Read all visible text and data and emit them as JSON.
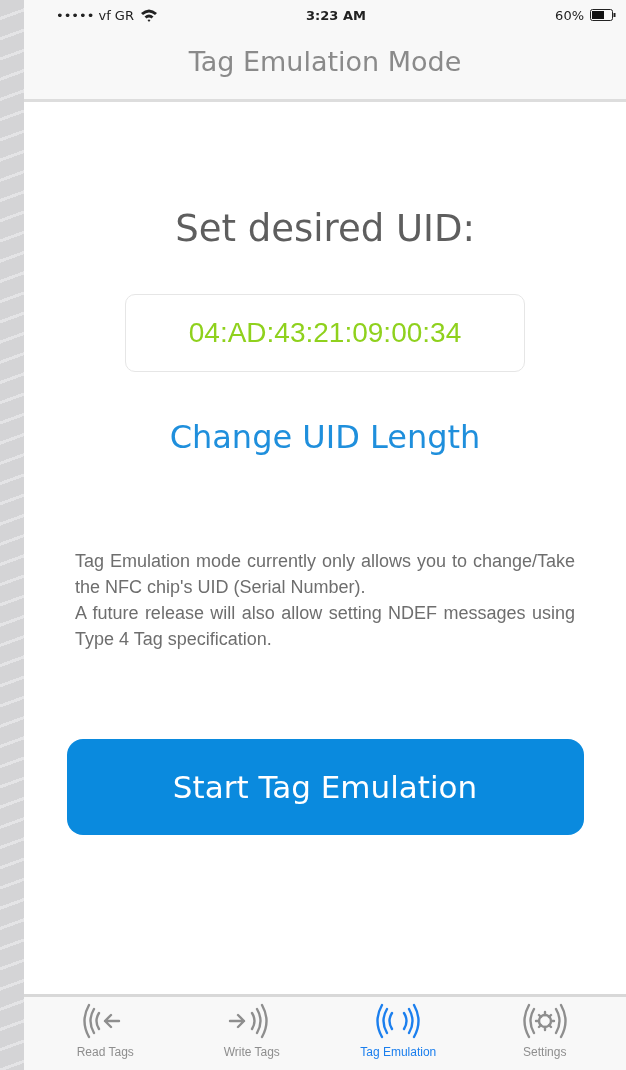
{
  "status_bar": {
    "carrier": "••••• vf GR",
    "time": "3:23 AM",
    "battery": "60%"
  },
  "nav": {
    "title": "Tag Emulation Mode"
  },
  "heading": "Set desired UID:",
  "uid_field": {
    "value": "04:AD:43:21:09:00:34"
  },
  "link": "Change UID Length",
  "description": [
    "Tag Emulation mode currently only allows you to change/Take the NFC chip's UID (Serial Number).",
    "A future release will also allow setting NDEF messages using Type 4 Tag specification."
  ],
  "button": "Start Tag Emulation",
  "tabs": [
    {
      "kind": "read",
      "label": "Read Tags",
      "selected": false
    },
    {
      "kind": "write",
      "label": "Write Tags",
      "selected": false
    },
    {
      "kind": "emulate",
      "label": "Tag Emulation",
      "selected": true
    },
    {
      "kind": "settings",
      "label": "Settings",
      "selected": false
    }
  ]
}
